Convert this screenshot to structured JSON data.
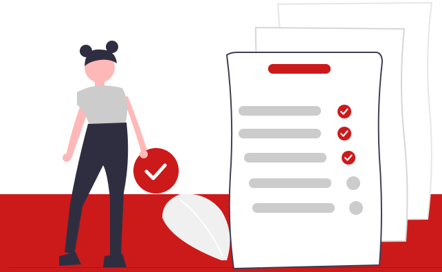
{
  "colors": {
    "accent": "#cc1a1a",
    "dark": "#2f2e41",
    "outline": "#3f3d56",
    "placeholder": "#cccccc",
    "leaf": "#f0f0f0",
    "skin": "#ffb8b8",
    "shirt": "#cccccc",
    "paper": "#ffffff"
  },
  "checklist": {
    "items": [
      {
        "state": "checked",
        "icon": "check-icon"
      },
      {
        "state": "checked",
        "icon": "check-icon"
      },
      {
        "state": "checked",
        "icon": "check-icon"
      },
      {
        "state": "pending",
        "icon": "empty-circle-icon"
      },
      {
        "state": "pending",
        "icon": "empty-circle-icon"
      }
    ]
  },
  "badge": {
    "icon": "checkmark-badge-icon"
  }
}
